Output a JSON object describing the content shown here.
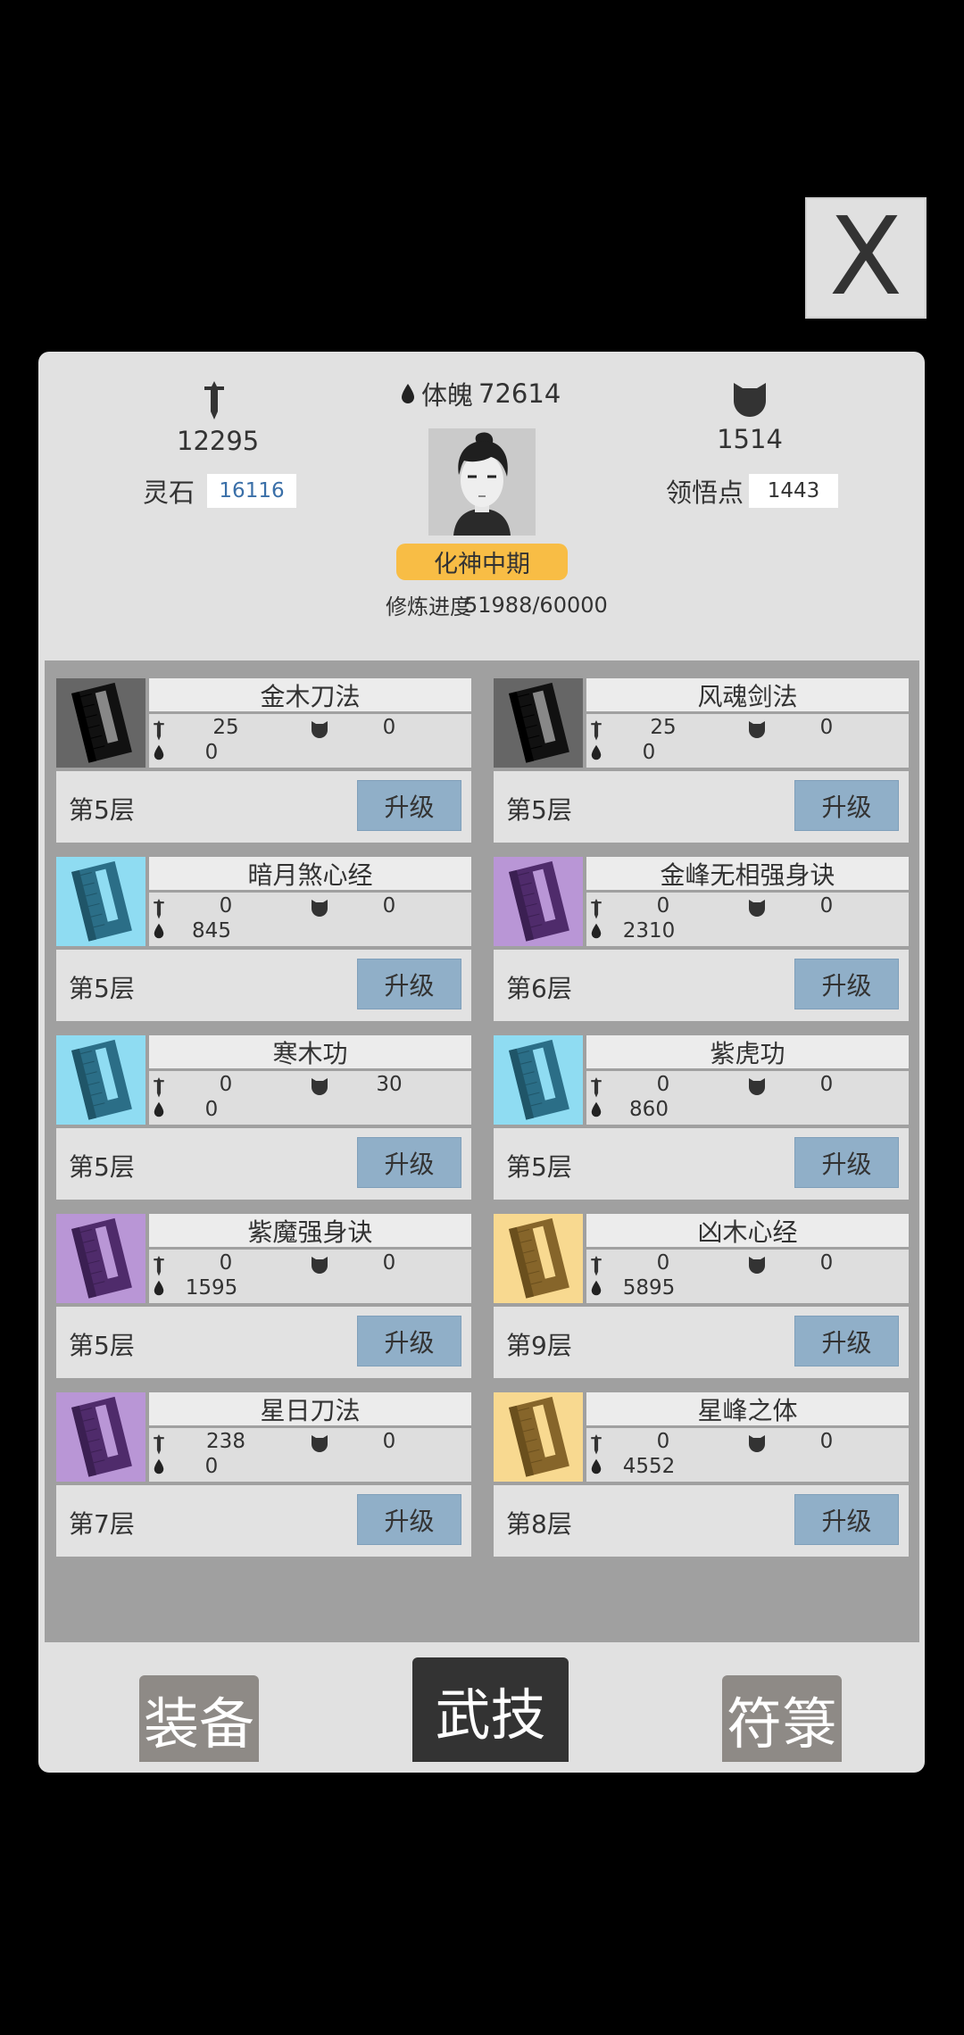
{
  "close_label": "X",
  "header": {
    "attack_value": "12295",
    "physique_label": "体魄",
    "physique_value": "72614",
    "defense_value": "1514",
    "spirit_stone_label": "灵石",
    "spirit_stone_value": "16116",
    "insight_label": "领悟点",
    "insight_value": "1443",
    "realm": "化神中期",
    "progress_label": "修炼进度",
    "progress_value": "51988/60000"
  },
  "upgrade_label": "升级",
  "skills": [
    {
      "name": "金木刀法",
      "atk": "25",
      "def": "0",
      "hp": "0",
      "layer": "第5层",
      "color": "black"
    },
    {
      "name": "风魂剑法",
      "atk": "25",
      "def": "0",
      "hp": "0",
      "layer": "第5层",
      "color": "black"
    },
    {
      "name": "暗月煞心经",
      "atk": "0",
      "def": "0",
      "hp": "845",
      "layer": "第5层",
      "color": "blue"
    },
    {
      "name": "金峰无相强身诀",
      "atk": "0",
      "def": "0",
      "hp": "2310",
      "layer": "第6层",
      "color": "purple"
    },
    {
      "name": "寒木功",
      "atk": "0",
      "def": "30",
      "hp": "0",
      "layer": "第5层",
      "color": "blue"
    },
    {
      "name": "紫虎功",
      "atk": "0",
      "def": "0",
      "hp": "860",
      "layer": "第5层",
      "color": "blue"
    },
    {
      "name": "紫魔强身诀",
      "atk": "0",
      "def": "0",
      "hp": "1595",
      "layer": "第5层",
      "color": "purple"
    },
    {
      "name": "凶木心经",
      "atk": "0",
      "def": "0",
      "hp": "5895",
      "layer": "第9层",
      "color": "gold"
    },
    {
      "name": "星日刀法",
      "atk": "238",
      "def": "0",
      "hp": "0",
      "layer": "第7层",
      "color": "purple"
    },
    {
      "name": "星峰之体",
      "atk": "0",
      "def": "0",
      "hp": "4552",
      "layer": "第8层",
      "color": "gold"
    }
  ],
  "book_colors": {
    "black": {
      "bg": "#666666",
      "cover": "#111111",
      "spine": "#000000",
      "stripe": "#888888"
    },
    "blue": {
      "bg": "#8fdcf2",
      "cover": "#2b6e87",
      "spine": "#1f5568",
      "stripe": "#8fdcf2"
    },
    "purple": {
      "bg": "#b996d6",
      "cover": "#4f2b6b",
      "spine": "#3b1f52",
      "stripe": "#b996d6"
    },
    "gold": {
      "bg": "#f8d990",
      "cover": "#86652a",
      "spine": "#6a4f1d",
      "stripe": "#f8d990"
    }
  },
  "tabs": {
    "equip": "装备",
    "skill": "武技",
    "talisman": "符箓"
  }
}
